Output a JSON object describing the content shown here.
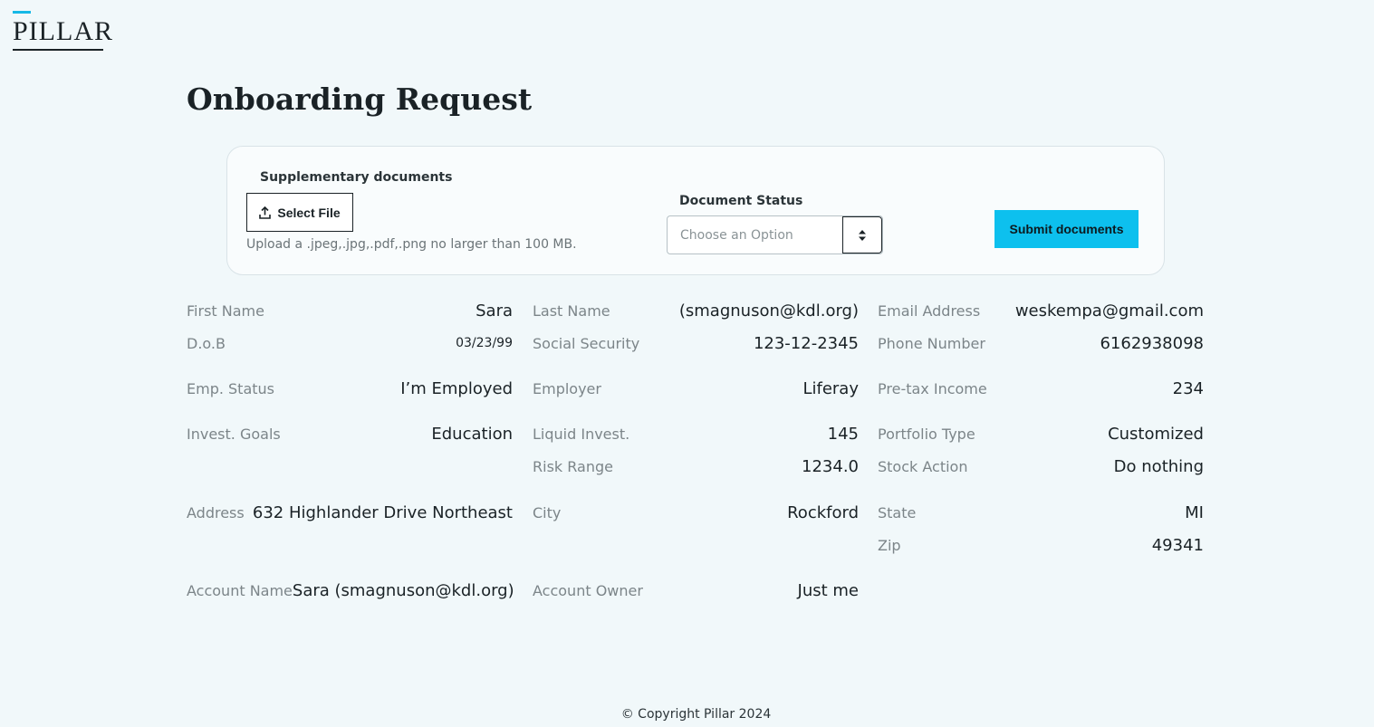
{
  "logo": {
    "text": "PILLAR",
    "accent_color": "#16b8e6"
  },
  "page_title": "Onboarding Request",
  "upload_card": {
    "supplementary_label": "Supplementary documents",
    "select_file_label": "Select File",
    "select_file_icon": "upload-icon",
    "upload_hint": "Upload a .jpeg,.jpg,.pdf,.png no larger than 100 MB.",
    "status_label": "Document Status",
    "status_placeholder": "Choose an Option",
    "status_icon": "select-arrows-icon",
    "submit_label": "Submit documents",
    "submit_color": "#0dc0ee"
  },
  "details": {
    "first_name": {
      "label": "First Name",
      "value": "Sara"
    },
    "last_name": {
      "label": "Last Name",
      "value": "(smagnuson@kdl.org)"
    },
    "email": {
      "label": "Email Address",
      "value": "weskempa@gmail.com"
    },
    "dob": {
      "label": "D.o.B",
      "value": "03/23/99"
    },
    "ssn": {
      "label": "Social Security",
      "value": "123-12-2345"
    },
    "phone": {
      "label": "Phone Number",
      "value": "6162938098"
    },
    "emp_status": {
      "label": "Emp. Status",
      "value": "I’m Employed"
    },
    "employer": {
      "label": "Employer",
      "value": "Liferay"
    },
    "pretax_income": {
      "label": "Pre-tax Income",
      "value": "234"
    },
    "invest_goals": {
      "label": "Invest. Goals",
      "value": "Education"
    },
    "liquid_invest": {
      "label": "Liquid Invest.",
      "value": "145"
    },
    "portfolio_type": {
      "label": "Portfolio Type",
      "value": "Customized"
    },
    "risk_range": {
      "label": "Risk Range",
      "value": "1234.0"
    },
    "stock_action": {
      "label": "Stock Action",
      "value": "Do nothing"
    },
    "address": {
      "label": "Address",
      "value": "632 Highlander Drive Northeast"
    },
    "city": {
      "label": "City",
      "value": "Rockford"
    },
    "state": {
      "label": "State",
      "value": "MI"
    },
    "zip": {
      "label": "Zip",
      "value": "49341"
    },
    "account_name": {
      "label": "Account Name",
      "value": "Sara (smagnuson@kdl.org)"
    },
    "account_owner": {
      "label": "Account Owner",
      "value": "Just me"
    }
  },
  "footer": {
    "copyright": "© Copyright Pillar 2024"
  }
}
